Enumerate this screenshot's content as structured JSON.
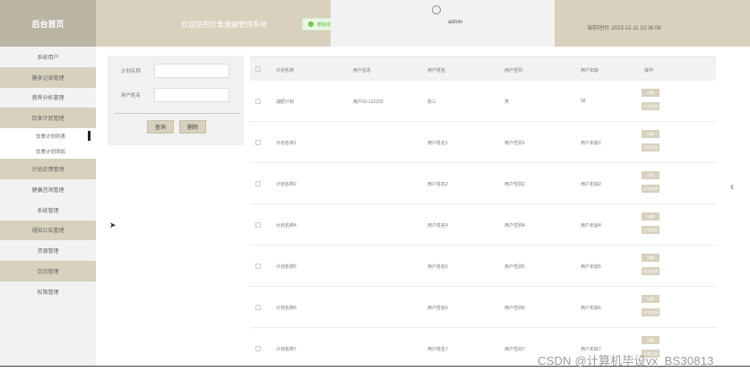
{
  "header": {
    "logo": "后台首页",
    "welcome": "欢迎使用饮食健康管理系统",
    "toast": "删除成功",
    "username": "admin",
    "time_label": "当前时间:",
    "time_value": "2023-12-11 10:36:08"
  },
  "sidebar": {
    "items": [
      {
        "label": "系统用户",
        "alt": false
      },
      {
        "label": "膳食记录管理",
        "alt": true
      },
      {
        "label": "营养分析管理",
        "alt": false
      },
      {
        "label": "饮食计划管理",
        "alt": true
      },
      {
        "label": "饮食计划列表",
        "sub": true,
        "active": true
      },
      {
        "label": "饮食计划添加",
        "sub": true
      },
      {
        "label": "计划反馈管理",
        "alt": true
      },
      {
        "label": "健康咨询管理",
        "alt": false
      },
      {
        "label": "系统管理",
        "alt": false
      },
      {
        "label": "通知公告管理",
        "alt": true
      },
      {
        "label": "资源管理",
        "alt": false
      },
      {
        "label": "交流管理",
        "alt": true
      },
      {
        "label": "权限管理",
        "alt": false
      }
    ]
  },
  "search": {
    "plan_name_label": "计划名称",
    "user_name_label": "用户姓名",
    "query_btn": "查询",
    "delete_btn": "删除"
  },
  "table": {
    "headers": [
      "计划名称",
      "用户信息",
      "用户姓名",
      "用户性别",
      "用户年龄",
      "操作"
    ],
    "rows": [
      [
        "减肥计划",
        "用户01-112233",
        "张三",
        "男",
        "58"
      ],
      [
        "计划名称1",
        "",
        "用户姓名1",
        "用户性别1",
        "用户年龄1"
      ],
      [
        "计划名称2",
        "",
        "用户姓名2",
        "用户性别2",
        "用户年龄2"
      ],
      [
        "计划名称4",
        "",
        "用户姓名4",
        "用户性别4",
        "用户年龄4"
      ],
      [
        "计划名称5",
        "",
        "用户姓名5",
        "用户性别5",
        "用户年龄5"
      ],
      [
        "计划名称6",
        "",
        "用户姓名6",
        "用户性别6",
        "用户年龄6"
      ],
      [
        "计划名称7",
        "",
        "用户姓名7",
        "用户性别7",
        "用户年龄7"
      ]
    ],
    "action_detail": "详情",
    "action_feedback": "计划反馈"
  },
  "watermark": "CSDN @计算机毕设vx_BS30813"
}
